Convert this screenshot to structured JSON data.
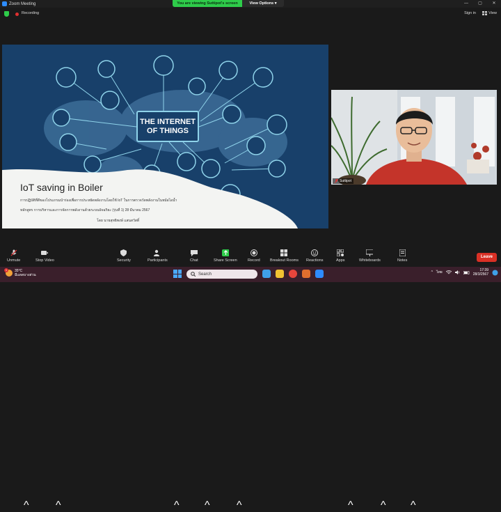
{
  "window": {
    "app_title": "Zoom Meeting",
    "controls": [
      "—",
      "▢",
      "✕"
    ]
  },
  "share_banner": {
    "viewing_text": "You are viewing Suttipot's screen",
    "view_options_label": "View Options"
  },
  "status": {
    "recording_label": "Recording",
    "sign_in_label": "Sign in",
    "view_label": "View"
  },
  "slide": {
    "hero_line1": "THE INTERNET",
    "hero_line2": "OF THINGS",
    "title": "IoT saving in Boiler",
    "subtitle_line1": "การปฏิบัติที่ดีของโปรแกรมนำร่องเพื่อการประหยัดพลังงานโดยใช้ IoT ในการตรวจวัดพลังงานในหม้อไอน้ำ",
    "subtitle_line2": "หลักสูตร การบริหารและการจัดการพลังงานด้วยระบบอัจฉริยะ (รุ่นที่ 1) 28 มีนาคม 2567",
    "author": "โดย นายสุทธิพงษ์ แสนสวัสดิ์"
  },
  "video": {
    "participant_name": "Suttipot"
  },
  "toolbar": {
    "items": [
      {
        "label": "Unmute",
        "icon": "mic-muted-icon"
      },
      {
        "label": "Stop Video",
        "icon": "video-icon"
      },
      {
        "label": "Security",
        "icon": "shield-icon"
      },
      {
        "label": "Participants",
        "icon": "participants-icon",
        "count": "10"
      },
      {
        "label": "Chat",
        "icon": "chat-icon"
      },
      {
        "label": "Share Screen",
        "icon": "share-screen-icon"
      },
      {
        "label": "Record",
        "icon": "record-icon"
      },
      {
        "label": "Breakout Rooms",
        "icon": "breakout-rooms-icon"
      },
      {
        "label": "Reactions",
        "icon": "reactions-icon"
      },
      {
        "label": "Apps",
        "icon": "apps-icon"
      },
      {
        "label": "Whiteboards",
        "icon": "whiteboard-icon"
      },
      {
        "label": "Notes",
        "icon": "notes-icon"
      }
    ],
    "leave_label": "Leave"
  },
  "taskbar": {
    "weather_temp": "35°C",
    "weather_desc": "มีแดดบางส่วน",
    "weather_badge": "1",
    "search_placeholder": "Search",
    "language": "ไทย",
    "time": "17:39",
    "date": "28/3/2567"
  },
  "colors": {
    "share_green": "#2ecc4a",
    "leave_red": "#d93025",
    "slide_blue": "#18406a",
    "accent_cyan": "#8fd3ea"
  }
}
